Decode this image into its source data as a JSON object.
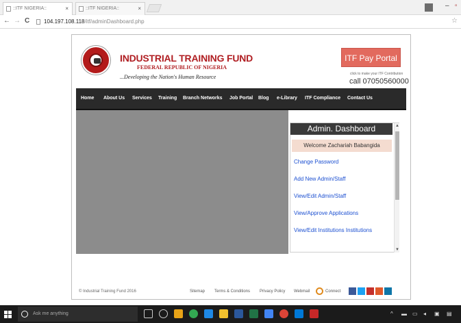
{
  "browser": {
    "tabs": [
      {
        "title": "::ITF NIGERIA::",
        "active": true
      },
      {
        "title": "::ITF NIGERIA::",
        "active": false
      }
    ],
    "url_host": "104.197.108.118",
    "url_path": "/itf/adminDashboard.php"
  },
  "header": {
    "org_name": "INDUSTRIAL TRAINING FUND",
    "org_subtitle": "FEDERAL REPUBLIC OF NIGERIA",
    "motto": "...Developing the Nation's Human Resource",
    "pay_portal_label": "ITF Pay Portal",
    "pay_note": "click to make your ITF Contribution",
    "phone": "call 07050560000"
  },
  "menu": {
    "items": [
      "Home",
      "About Us",
      "Services",
      "Training",
      "Branch Networks",
      "Job Portal",
      "Blog",
      "e-Library",
      "ITF Compliance",
      "Contact Us"
    ]
  },
  "admin": {
    "title": "Admin. Dashboard",
    "welcome": "Welcome Zachariah Babangida",
    "links": [
      "Change Password",
      "Add New Admin/Staff",
      "View/Edit Admin/Staff",
      "View/Approve Applications",
      "View/Edit Institutions Institutions"
    ]
  },
  "footer": {
    "copyright": "© Industrial Training Fund 2016",
    "links": [
      "Sitemap",
      "Terms & Conditions",
      "Privacy Policy",
      "Webmail"
    ],
    "connect_label": "Connect"
  },
  "taskbar": {
    "search_placeholder": "Ask me anything"
  },
  "colors": {
    "brand_red": "#b01e22",
    "pay_button": "#e26a5e",
    "menubar": "#2a2a2a",
    "link_blue": "#1b4fd1"
  }
}
